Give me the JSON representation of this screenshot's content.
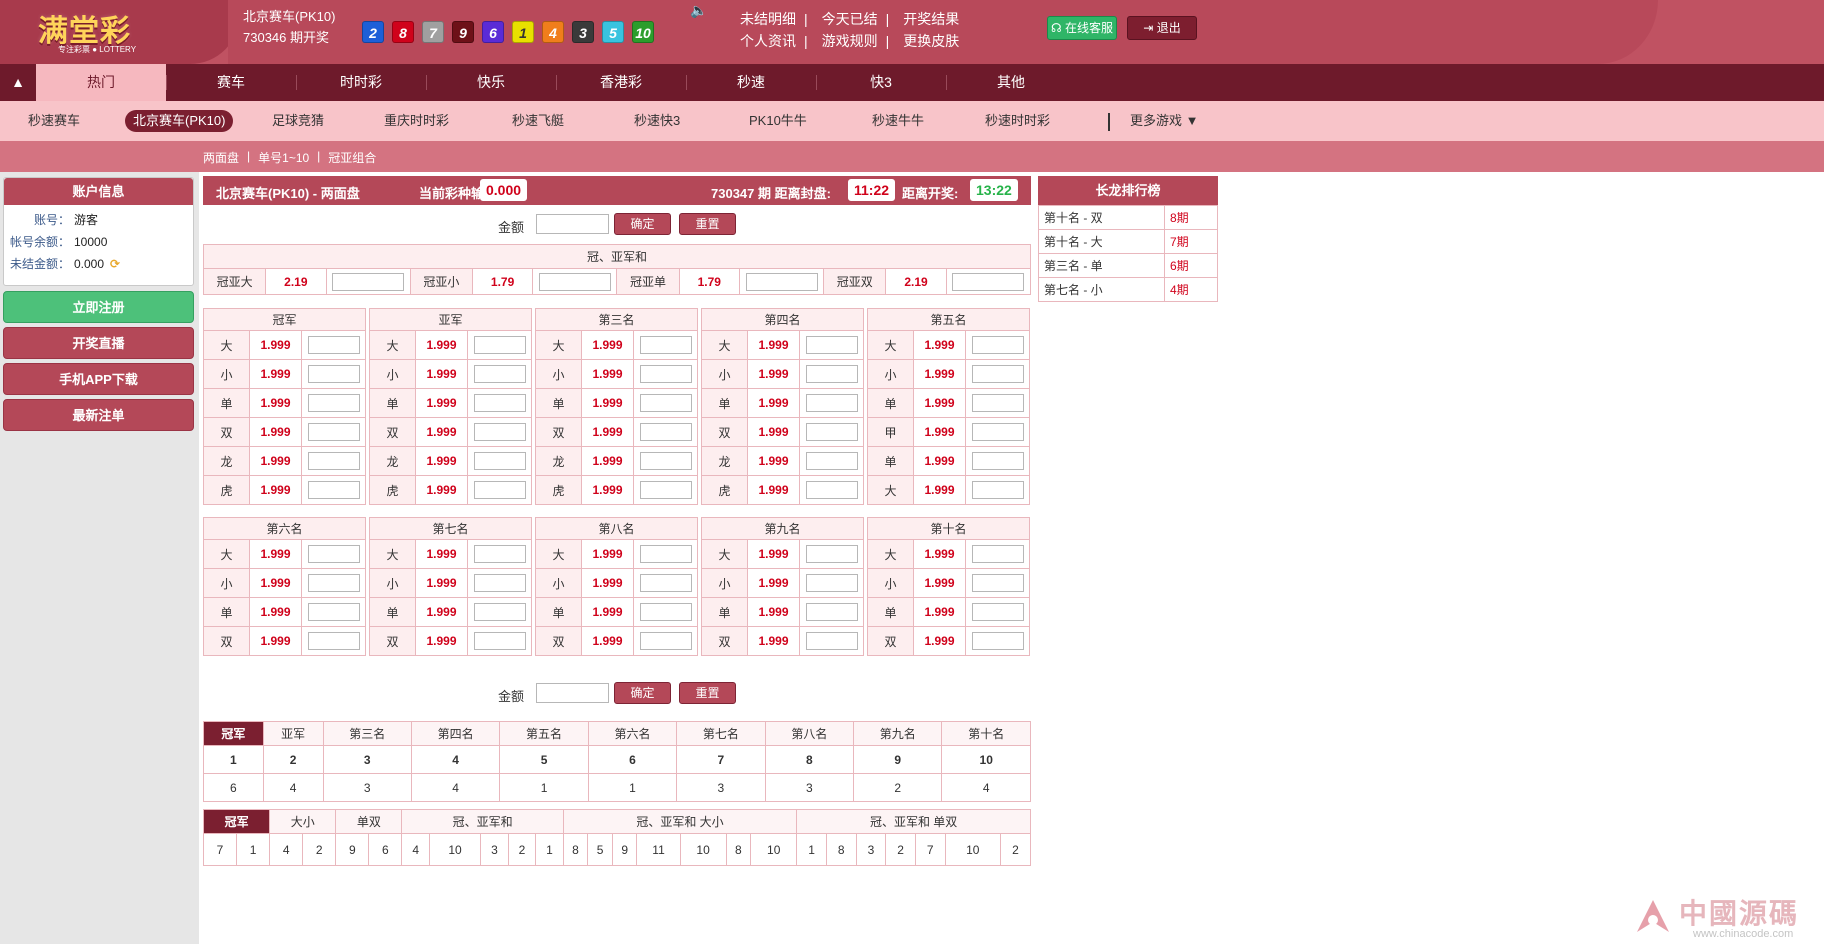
{
  "header": {
    "logo_main": "满堂彩",
    "logo_sub": "专注彩票 ● LOTTERY",
    "lottery_name": "北京赛车(PK10)",
    "draw_open": "730346 期开奖",
    "balls": [
      {
        "num": "2",
        "color": "#1d5fd8"
      },
      {
        "num": "8",
        "color": "#d0021b"
      },
      {
        "num": "7",
        "color": "#a0a0a0"
      },
      {
        "num": "9",
        "color": "#6d1118"
      },
      {
        "num": "6",
        "color": "#5a2bd6"
      },
      {
        "num": "1",
        "color": "#e8e000"
      },
      {
        "num": "4",
        "color": "#f07e1b"
      },
      {
        "num": "3",
        "color": "#3a3a3a"
      },
      {
        "num": "5",
        "color": "#39c3df"
      },
      {
        "num": "10",
        "color": "#2c9d2c"
      }
    ],
    "links_row1": [
      "未结明细",
      "今天已结",
      "开奖结果"
    ],
    "links_row2": [
      "个人资讯",
      "游戏规则",
      "更换皮肤"
    ],
    "service_label": "在线客服",
    "logout_label": "退出"
  },
  "main_nav": {
    "tabs": [
      "热门",
      "赛车",
      "时时彩",
      "快乐",
      "香港彩",
      "秒速",
      "快3",
      "其他"
    ]
  },
  "sub_nav": {
    "items": [
      "秒速赛车",
      "北京赛车(PK10)",
      "足球竞猜",
      "重庆时时彩",
      "秒速飞艇",
      "秒速快3",
      "PK10牛牛",
      "秒速牛牛",
      "秒速时时彩"
    ],
    "more": "更多游戏 ▼"
  },
  "sub_tabs": [
    "两面盘",
    "|",
    "单号1~10",
    "|",
    "冠亚组合"
  ],
  "account": {
    "title": "账户信息",
    "rows": [
      {
        "label": "账号：",
        "value": "游客"
      },
      {
        "label": "帐号余额：",
        "value": "10000"
      },
      {
        "label": "未结金额：",
        "value": "0.000"
      }
    ]
  },
  "side_buttons": [
    "立即注册",
    "开奖直播",
    "手机APP下载",
    "最新注单"
  ],
  "title_bar": {
    "game": "北京赛车(PK10)  -  两面盘",
    "profit_label": "当前彩种输赢:",
    "profit": "0.000",
    "issue_label": "730347 期  距离封盘:",
    "close_time": "11:22",
    "open_label": "距离开奖:",
    "open_time": "13:22"
  },
  "amount": {
    "label": "金额",
    "confirm": "确定",
    "reset": "重置"
  },
  "combo": {
    "title": "冠、亚军和",
    "items": [
      {
        "name": "冠亚大",
        "odds": "2.19"
      },
      {
        "name": "冠亚小",
        "odds": "1.79"
      },
      {
        "name": "冠亚单",
        "odds": "1.79"
      },
      {
        "name": "冠亚双",
        "odds": "2.19"
      }
    ]
  },
  "positions_top": [
    {
      "title": "冠军",
      "rows": [
        [
          "大",
          "1.999"
        ],
        [
          "小",
          "1.999"
        ],
        [
          "单",
          "1.999"
        ],
        [
          "双",
          "1.999"
        ],
        [
          "龙",
          "1.999"
        ],
        [
          "虎",
          "1.999"
        ]
      ]
    },
    {
      "title": "亚军",
      "rows": [
        [
          "大",
          "1.999"
        ],
        [
          "小",
          "1.999"
        ],
        [
          "单",
          "1.999"
        ],
        [
          "双",
          "1.999"
        ],
        [
          "龙",
          "1.999"
        ],
        [
          "虎",
          "1.999"
        ]
      ]
    },
    {
      "title": "第三名",
      "rows": [
        [
          "大",
          "1.999"
        ],
        [
          "小",
          "1.999"
        ],
        [
          "单",
          "1.999"
        ],
        [
          "双",
          "1.999"
        ],
        [
          "龙",
          "1.999"
        ],
        [
          "虎",
          "1.999"
        ]
      ]
    },
    {
      "title": "第四名",
      "rows": [
        [
          "大",
          "1.999"
        ],
        [
          "小",
          "1.999"
        ],
        [
          "单",
          "1.999"
        ],
        [
          "双",
          "1.999"
        ],
        [
          "龙",
          "1.999"
        ],
        [
          "虎",
          "1.999"
        ]
      ]
    },
    {
      "title": "第五名",
      "rows": [
        [
          "大",
          "1.999"
        ],
        [
          "小",
          "1.999"
        ],
        [
          "单",
          "1.999"
        ],
        [
          "甲",
          "1.999"
        ],
        [
          "单",
          "1.999"
        ],
        [
          "大",
          "1.999"
        ]
      ]
    }
  ],
  "positions_bottom": [
    {
      "title": "第六名",
      "rows": [
        [
          "大",
          "1.999"
        ],
        [
          "小",
          "1.999"
        ],
        [
          "单",
          "1.999"
        ],
        [
          "双",
          "1.999"
        ]
      ]
    },
    {
      "title": "第七名",
      "rows": [
        [
          "大",
          "1.999"
        ],
        [
          "小",
          "1.999"
        ],
        [
          "单",
          "1.999"
        ],
        [
          "双",
          "1.999"
        ]
      ]
    },
    {
      "title": "第八名",
      "rows": [
        [
          "大",
          "1.999"
        ],
        [
          "小",
          "1.999"
        ],
        [
          "单",
          "1.999"
        ],
        [
          "双",
          "1.999"
        ]
      ]
    },
    {
      "title": "第九名",
      "rows": [
        [
          "大",
          "1.999"
        ],
        [
          "小",
          "1.999"
        ],
        [
          "单",
          "1.999"
        ],
        [
          "双",
          "1.999"
        ]
      ]
    },
    {
      "title": "第十名",
      "rows": [
        [
          "大",
          "1.999"
        ],
        [
          "小",
          "1.999"
        ],
        [
          "单",
          "1.999"
        ],
        [
          "双",
          "1.999"
        ]
      ]
    }
  ],
  "results": {
    "headers": [
      "冠军",
      "亚军",
      "第三名",
      "第四名",
      "第五名",
      "第六名",
      "第七名",
      "第八名",
      "第九名",
      "第十名"
    ],
    "numbers": [
      "1",
      "2",
      "3",
      "4",
      "5",
      "6",
      "7",
      "8",
      "9",
      "10"
    ],
    "counts": [
      "6",
      "4",
      "3",
      "4",
      "1",
      "1",
      "3",
      "3",
      "2",
      "4"
    ]
  },
  "history": {
    "headers": [
      "冠军",
      "大小",
      "单双",
      "冠、亚军和",
      "冠、亚军和 大小",
      "冠、亚军和 单双"
    ],
    "values": [
      "7",
      "1",
      "4",
      "2",
      "9",
      "6",
      "4",
      "10",
      "3",
      "2",
      "1",
      "8",
      "5",
      "9",
      "11",
      "10",
      "8",
      "10",
      "1",
      "8",
      "3",
      "2",
      "7",
      "10",
      "2"
    ]
  },
  "long_dragon": {
    "title": "长龙排行榜",
    "rows": [
      {
        "name": "第十名 - 双",
        "val": "8期"
      },
      {
        "name": "第十名 - 大",
        "val": "7期"
      },
      {
        "name": "第三名 - 单",
        "val": "6期"
      },
      {
        "name": "第七名 - 小",
        "val": "4期"
      }
    ]
  },
  "watermark": {
    "text": "中國源碼",
    "url": "www.chinacode.com"
  }
}
